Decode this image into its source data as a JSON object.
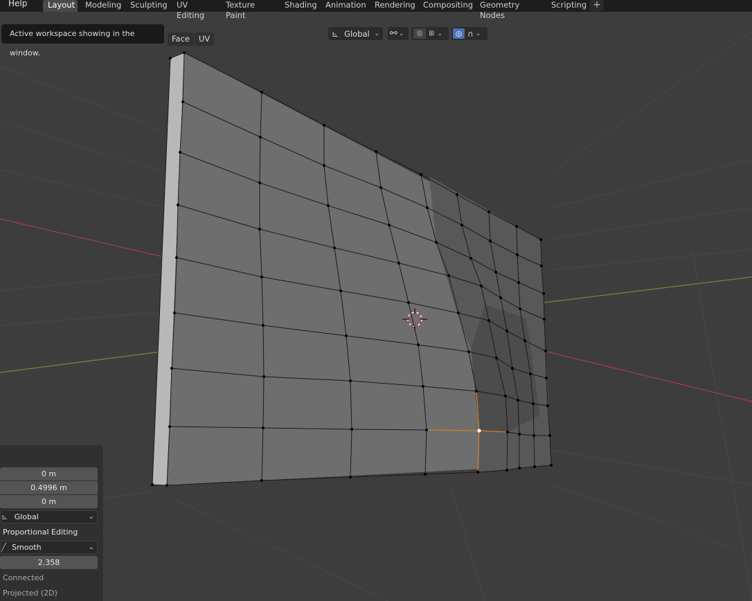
{
  "menu": {
    "help": "Help"
  },
  "workspace_tabs": [
    {
      "label": "Layout",
      "active": true
    },
    {
      "label": "Modeling"
    },
    {
      "label": "Sculpting"
    },
    {
      "label": "UV Editing"
    },
    {
      "label": "Texture Paint"
    },
    {
      "label": "Shading"
    },
    {
      "label": "Animation"
    },
    {
      "label": "Rendering"
    },
    {
      "label": "Compositing"
    },
    {
      "label": "Geometry Nodes"
    },
    {
      "label": "Scripting"
    }
  ],
  "add_workspace_icon": "plus-icon",
  "viewport_header": {
    "transform_orientation": "Global",
    "pivot_icon": "pivot-icon",
    "link_icon": "link-icon",
    "snap_icon": "snap-icon",
    "snap_increment_icon": "snap-increment-icon",
    "proportional_icon": "proportional-editing-icon",
    "falloff_icon": "falloff-curve-icon"
  },
  "tooltip": {
    "text": "Active workspace showing in the window."
  },
  "mesh_menus": {
    "face": "Face",
    "uv": "UV"
  },
  "operator_panel": {
    "move_x": "0 m",
    "move_y": "0.4996 m",
    "move_z": "0 m",
    "orientation": "Global",
    "proportional_editing": "Proportional Editing",
    "falloff": "Smooth",
    "size": "2.358",
    "connected": "Connected",
    "projected": "Projected (2D)"
  },
  "colors": {
    "background": "#3d3d3d",
    "x_axis": "#a23c48",
    "y_axis": "#6b8a3a",
    "selected_vertex": "#ff9a2e",
    "active_tab": "#4a4a4a"
  }
}
